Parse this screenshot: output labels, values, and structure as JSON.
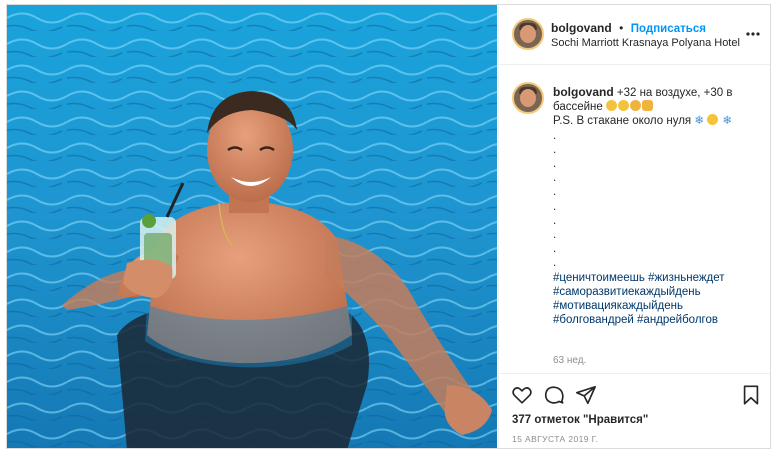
{
  "header": {
    "username": "bolgovand",
    "separator": "•",
    "follow_label": "Подписаться",
    "location": "Sochi Marriott Krasnaya Polyana Hotel",
    "more_icon": "ellipsis-icon"
  },
  "caption": {
    "username": "bolgovand",
    "line1": "+32 на воздухе, +30 в",
    "line2": "бассейне",
    "line3": "P.S. В стакане около нуля",
    "dots": [
      ".",
      ".",
      ".",
      ".",
      ".",
      ".",
      ".",
      ".",
      ".",
      "."
    ],
    "hashtags": [
      [
        "#ценичтоимеешь",
        "#жизньнеждет"
      ],
      [
        "#саморазвитиекаждыйдень"
      ],
      [
        "#мотивациякаждыйдень"
      ],
      [
        "#болговандрей",
        "#андрейболгов"
      ]
    ],
    "time_ago": "63 нед."
  },
  "actions": {
    "icons": [
      "heart-icon",
      "comment-icon",
      "share-icon",
      "bookmark-icon"
    ],
    "likes": "377 отметок \"Нравится\"",
    "date": "15 АВГУСТА 2019 Г."
  },
  "colors": {
    "link": "#0095f6",
    "hashtag": "#00376b",
    "muted": "#8e8e8e",
    "pool": "#1f9fd6"
  }
}
